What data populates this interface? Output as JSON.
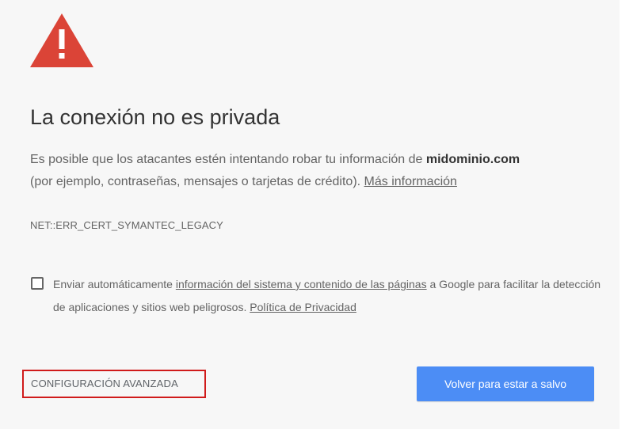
{
  "colors": {
    "background": "#f7f7f7",
    "warning_icon": "#db4437",
    "primary_button": "#4c8df5",
    "highlight_border": "#d01b1b",
    "body_text": "#646464",
    "title_text": "#333333"
  },
  "icon": {
    "name": "warning-triangle-icon"
  },
  "heading": "La conexión no es privada",
  "description": {
    "text_before": "Es posible que los atacantes estén intentando robar tu información de ",
    "domain": "midominio.com",
    "text_after": " (por ejemplo, contraseñas, mensajes o tarjetas de crédito). ",
    "learn_more_link": "Más información"
  },
  "error_code": "NET::ERR_CERT_SYMANTEC_LEGACY",
  "optin": {
    "checked": false,
    "text_before": "Enviar automáticamente ",
    "link_system_info": "información del sistema y contenido de las páginas",
    "text_after": " a Google para facilitar la detección de aplicaciones y sitios web peligrosos. ",
    "link_privacy": "Política de Privacidad"
  },
  "buttons": {
    "advanced_label": "CONFIGURACIÓN AVANZADA",
    "back_label": "Volver para estar a salvo"
  }
}
